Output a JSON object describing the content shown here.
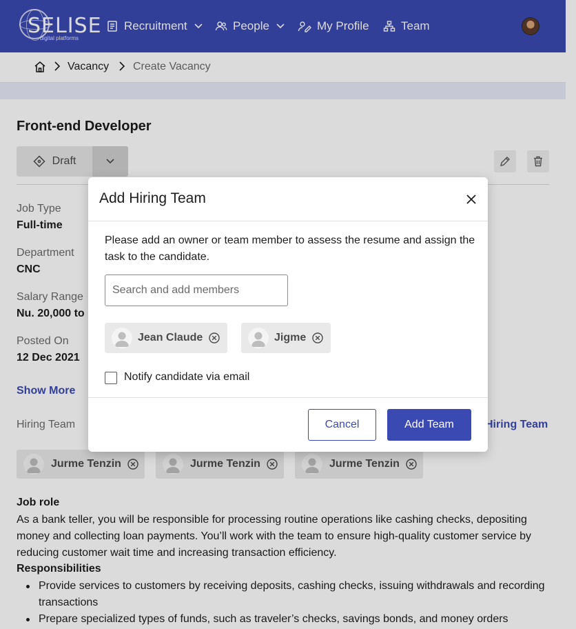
{
  "nav": {
    "logo_text": "SELISE",
    "logo_tagline": "digital platforms",
    "items": [
      {
        "label": "Recruitment",
        "icon": "document-list-icon",
        "has_dropdown": true
      },
      {
        "label": "People",
        "icon": "people-icon",
        "has_dropdown": true
      },
      {
        "label": "My Profile",
        "icon": "profile-edit-icon",
        "has_dropdown": false
      },
      {
        "label": "Team",
        "icon": "team-hierarchy-icon",
        "has_dropdown": false
      }
    ]
  },
  "breadcrumb": {
    "items": [
      "Vacancy",
      "Create Vacancy"
    ]
  },
  "vacancy": {
    "title": "Front-end Developer",
    "status": "Draft",
    "fields": [
      {
        "label": "Job Type",
        "value": "Full-time"
      },
      {
        "label": "Department",
        "value": "CNC"
      },
      {
        "label": "Salary Range",
        "value": "Nu. 20,000 to"
      },
      {
        "label": "Posted On",
        "value": "12 Dec 2021"
      }
    ],
    "show_more": "Show More",
    "hiring_team_label": "Hiring Team",
    "add_hiring_team_link": "Hiring Team",
    "hiring_team": [
      "Jurme Tenzin",
      "Jurme Tenzin",
      "Jurme Tenzin"
    ],
    "job_role_heading": "Job role",
    "job_role_text": "As a bank teller, you will be responsible for processing routine operations like cashing checks, depositing money and collecting loan payments. You’ll work with the team to ensure high-quality customer service by reducing customer wait time and increasing transaction efficiency.",
    "responsibilities_heading": "Responsibilities",
    "responsibilities": [
      "Provide services to customers by receiving deposits, cashing checks, issuing withdrawals and recording transactions",
      "Prepare specialized types of funds, such as traveler’s checks, savings bonds, and money orders"
    ]
  },
  "modal": {
    "title": "Add Hiring Team",
    "description": "Please add an owner or team member to assess the resume and assign the task to the candidate.",
    "search_placeholder": "Search and add members",
    "selected_members": [
      "Jean Claude",
      "Jigme"
    ],
    "notify_label": "Notify candidate via email",
    "notify_checked": false,
    "cancel_label": "Cancel",
    "submit_label": "Add Team"
  },
  "colors": {
    "brand": "#3b4ab3",
    "chip_bg": "#e9e9e9"
  }
}
